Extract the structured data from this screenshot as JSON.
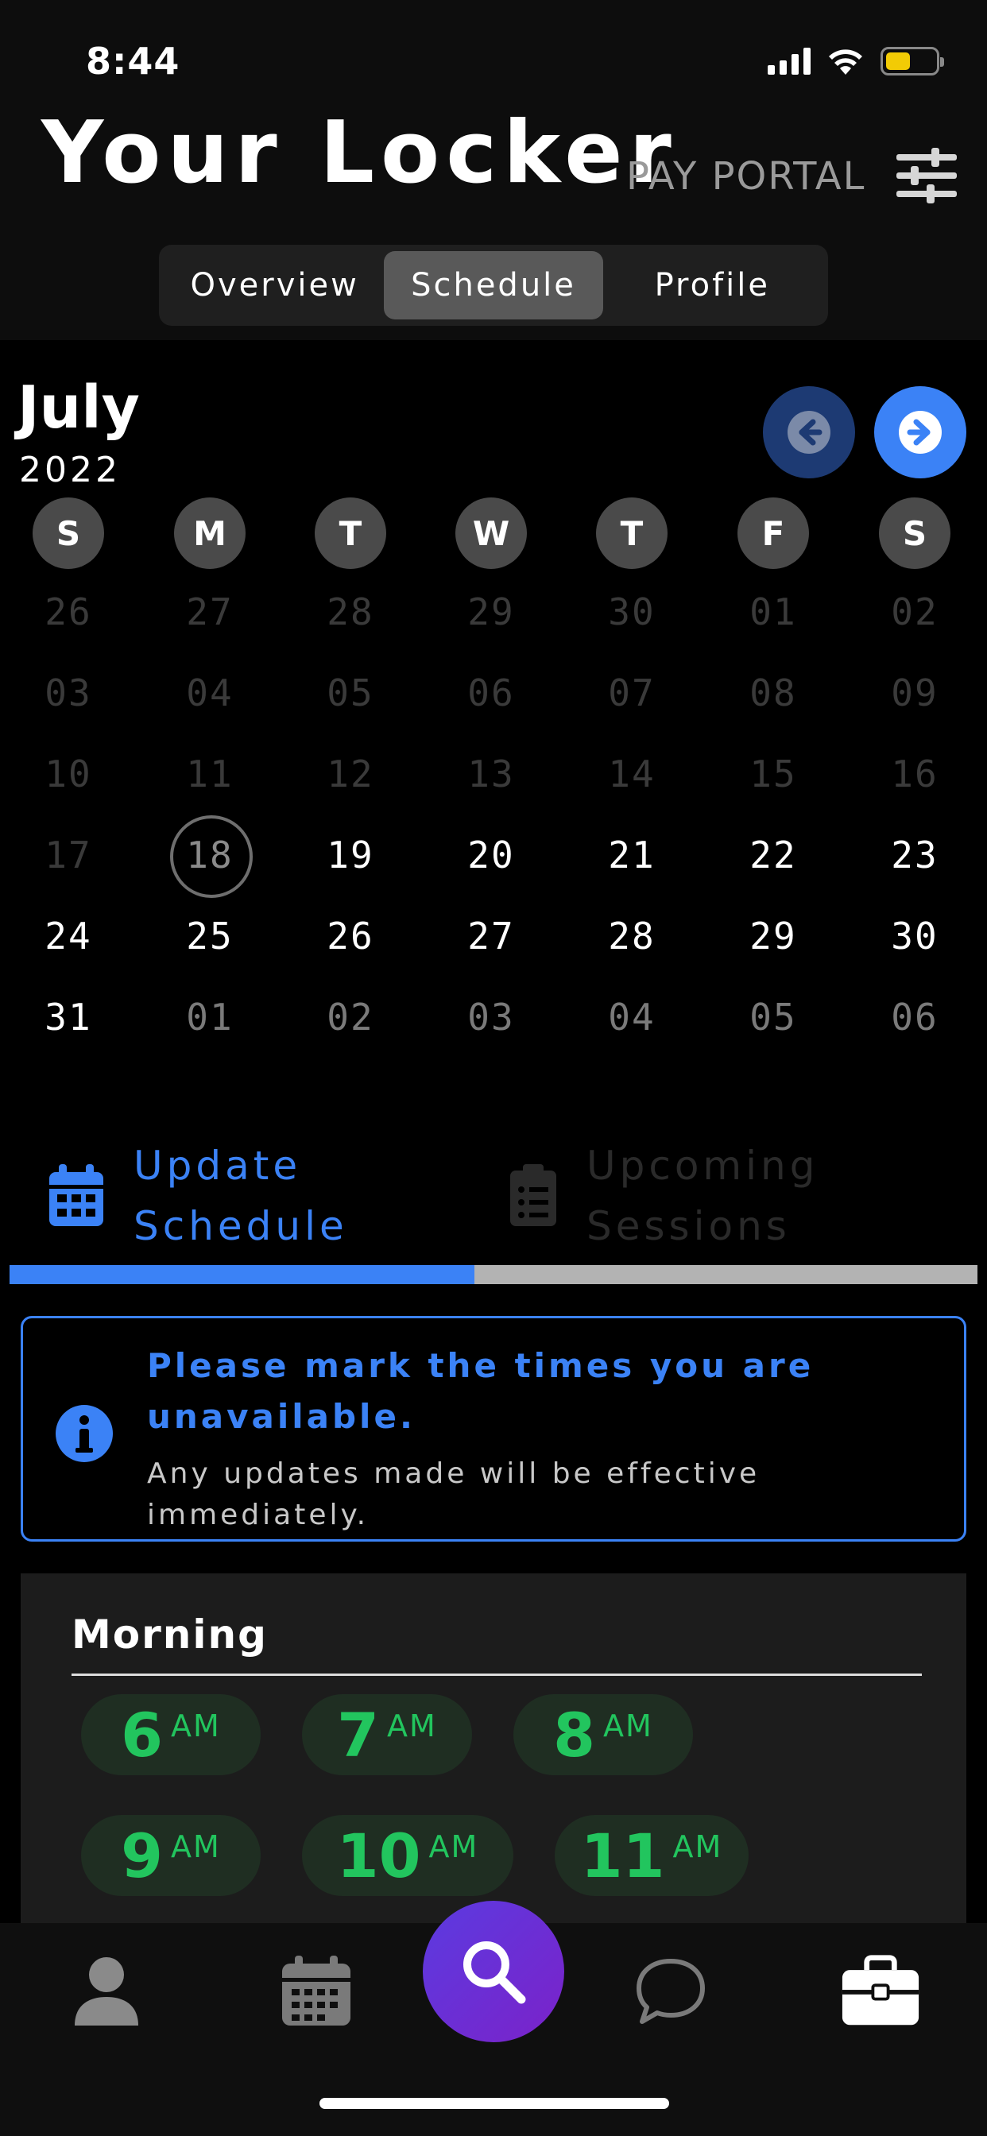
{
  "status": {
    "time": "8:44"
  },
  "header": {
    "title": "Your Locker",
    "pay_portal": "PAY PORTAL"
  },
  "tabs": [
    {
      "label": "Overview",
      "active": false
    },
    {
      "label": "Schedule",
      "active": true
    },
    {
      "label": "Profile",
      "active": false
    }
  ],
  "calendar": {
    "month": "July",
    "year": "2022",
    "weekdays": [
      "S",
      "M",
      "T",
      "W",
      "T",
      "F",
      "S"
    ],
    "weeks": [
      [
        [
          "26",
          "past"
        ],
        [
          "27",
          "past"
        ],
        [
          "28",
          "past"
        ],
        [
          "29",
          "past"
        ],
        [
          "30",
          "past"
        ],
        [
          "01",
          "past"
        ],
        [
          "02",
          "past"
        ]
      ],
      [
        [
          "03",
          "past"
        ],
        [
          "04",
          "past"
        ],
        [
          "05",
          "past"
        ],
        [
          "06",
          "past"
        ],
        [
          "07",
          "past"
        ],
        [
          "08",
          "past"
        ],
        [
          "09",
          "past"
        ]
      ],
      [
        [
          "10",
          "past"
        ],
        [
          "11",
          "past"
        ],
        [
          "12",
          "past"
        ],
        [
          "13",
          "past"
        ],
        [
          "14",
          "past"
        ],
        [
          "15",
          "past"
        ],
        [
          "16",
          "past"
        ]
      ],
      [
        [
          "17",
          "past"
        ],
        [
          "18",
          "today"
        ],
        [
          "19",
          "current"
        ],
        [
          "20",
          "current"
        ],
        [
          "21",
          "current"
        ],
        [
          "22",
          "current"
        ],
        [
          "23",
          "current"
        ]
      ],
      [
        [
          "24",
          "current"
        ],
        [
          "25",
          "current"
        ],
        [
          "26",
          "current"
        ],
        [
          "27",
          "current"
        ],
        [
          "28",
          "current"
        ],
        [
          "29",
          "current"
        ],
        [
          "30",
          "current"
        ]
      ],
      [
        [
          "31",
          "current"
        ],
        [
          "01",
          "other"
        ],
        [
          "02",
          "other"
        ],
        [
          "03",
          "other"
        ],
        [
          "04",
          "other"
        ],
        [
          "05",
          "other"
        ],
        [
          "06",
          "other"
        ]
      ]
    ]
  },
  "sections": {
    "update": {
      "line1": "Update",
      "line2": "Schedule"
    },
    "upcoming": {
      "line1": "Upcoming",
      "line2": "Sessions"
    },
    "progress_fraction": 0.48
  },
  "info": {
    "main": "Please mark the times you are unavailable.",
    "sub": "Any updates made will be effective immediately."
  },
  "morning": {
    "title": "Morning",
    "slots": [
      {
        "hour": "6",
        "period": "AM"
      },
      {
        "hour": "7",
        "period": "AM"
      },
      {
        "hour": "8",
        "period": "AM"
      },
      {
        "hour": "9",
        "period": "AM"
      },
      {
        "hour": "10",
        "period": "AM"
      },
      {
        "hour": "11",
        "period": "AM"
      }
    ]
  },
  "nav": {
    "icons": [
      "person-icon",
      "calendar-icon",
      "search-icon",
      "chat-icon",
      "briefcase-icon"
    ]
  },
  "colors": {
    "accent": "#3b82f6",
    "slot_green": "#22c55e",
    "fab_gradient_start": "#5b3be0",
    "fab_gradient_end": "#7b22c9"
  }
}
